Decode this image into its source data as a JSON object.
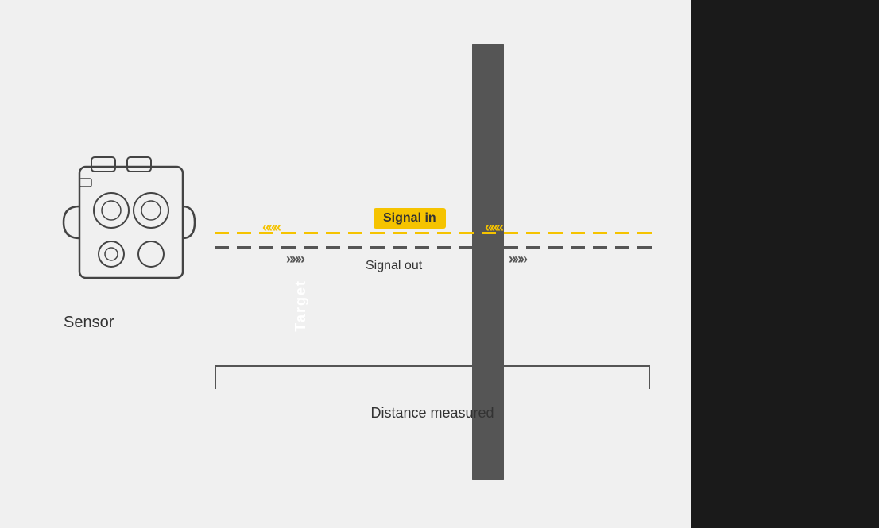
{
  "diagram": {
    "sensor_label": "Sensor",
    "target_label": "Target",
    "signal_in_label": "Signal in",
    "signal_out_label": "Signal out",
    "distance_label": "Distance measured",
    "arrow_left": "«««",
    "arrow_right": "»»»"
  },
  "colors": {
    "background": "#f0f0f0",
    "right_panel": "#1a1a1a",
    "target_bar": "#555555",
    "yellow": "#f5c300",
    "dark_arrow": "#555555",
    "text": "#333333"
  }
}
